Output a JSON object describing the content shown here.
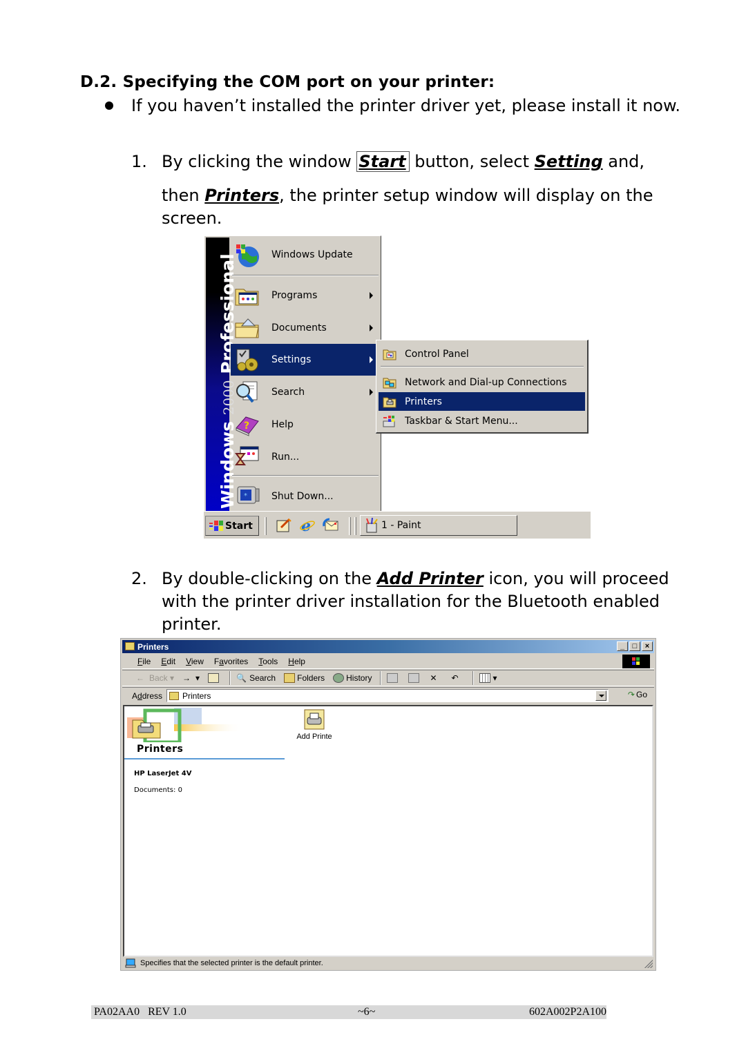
{
  "section": {
    "heading": "D.2. Specifying the COM port on your printer:",
    "bullet": "If you haven’t installed the printer driver yet, please install it now.",
    "step1": {
      "number": "1.",
      "part1": "By clicking the window ",
      "kw_start": "Start",
      "part2": " button, select ",
      "kw_setting": "Setting",
      "part3": " and,",
      "line2_part1": "then ",
      "kw_printers": "Printers",
      "line2_part2": ", the printer setup window will display on the screen."
    },
    "step2": {
      "number": "2.",
      "part1": "By double-clicking on the ",
      "kw_add_printer": "Add Printer",
      "part2": " icon, you will proceed with the printer driver installation for the Bluetooth enabled printer."
    }
  },
  "start_menu": {
    "sidebar_text_brand": "Windows",
    "sidebar_text_year": "2000",
    "sidebar_text_edition": "Professional",
    "items": [
      {
        "label": "Windows Update",
        "icon": "windows-update-icon",
        "submenu": false
      },
      {
        "label": "Programs",
        "icon": "programs-icon",
        "submenu": true
      },
      {
        "label": "Documents",
        "icon": "documents-icon",
        "submenu": true
      },
      {
        "label": "Settings",
        "icon": "settings-icon",
        "submenu": true,
        "selected": true
      },
      {
        "label": "Search",
        "icon": "search-icon",
        "submenu": true
      },
      {
        "label": "Help",
        "icon": "help-icon",
        "submenu": false
      },
      {
        "label": "Run...",
        "icon": "run-icon",
        "submenu": false
      },
      {
        "label": "Shut Down...",
        "icon": "shutdown-icon",
        "submenu": false
      }
    ],
    "settings_submenu": [
      {
        "label": "Control Panel",
        "icon": "control-panel-icon"
      },
      {
        "label": "Network and Dial-up Connections",
        "icon": "network-icon"
      },
      {
        "label": "Printers",
        "icon": "printers-folder-icon",
        "selected": true
      },
      {
        "label": "Taskbar & Start Menu...",
        "icon": "taskbar-icon"
      }
    ],
    "selection_color": "#0a246a"
  },
  "taskbar": {
    "start_label": "Start",
    "quicklaunch": [
      "show-desktop-icon",
      "internet-explorer-icon",
      "outlook-express-icon"
    ],
    "task_label": "1 - Paint"
  },
  "printers_window": {
    "title": "Printers",
    "menu": [
      "File",
      "Edit",
      "View",
      "Favorites",
      "Tools",
      "Help"
    ],
    "menu_accel": [
      "F",
      "E",
      "V",
      "a",
      "T",
      "H"
    ],
    "toolbar": {
      "back": "Back",
      "search": "Search",
      "folders": "Folders",
      "history": "History"
    },
    "address_label": "Address",
    "address_value": "Printers",
    "go_label": "Go",
    "banner_title": "Printers",
    "printer_name": "HP LaserJet 4V",
    "printer_documents": "Documents: 0",
    "add_printer_label": "Add Printe",
    "status_text": "Specifies that the selected printer is the default printer.",
    "window_buttons": {
      "minimize": "_",
      "maximize": "□",
      "close": "×"
    }
  },
  "footer": {
    "left": "PA02AA0   REV 1.0",
    "center": "~6~",
    "right": "602A002P2A100"
  }
}
